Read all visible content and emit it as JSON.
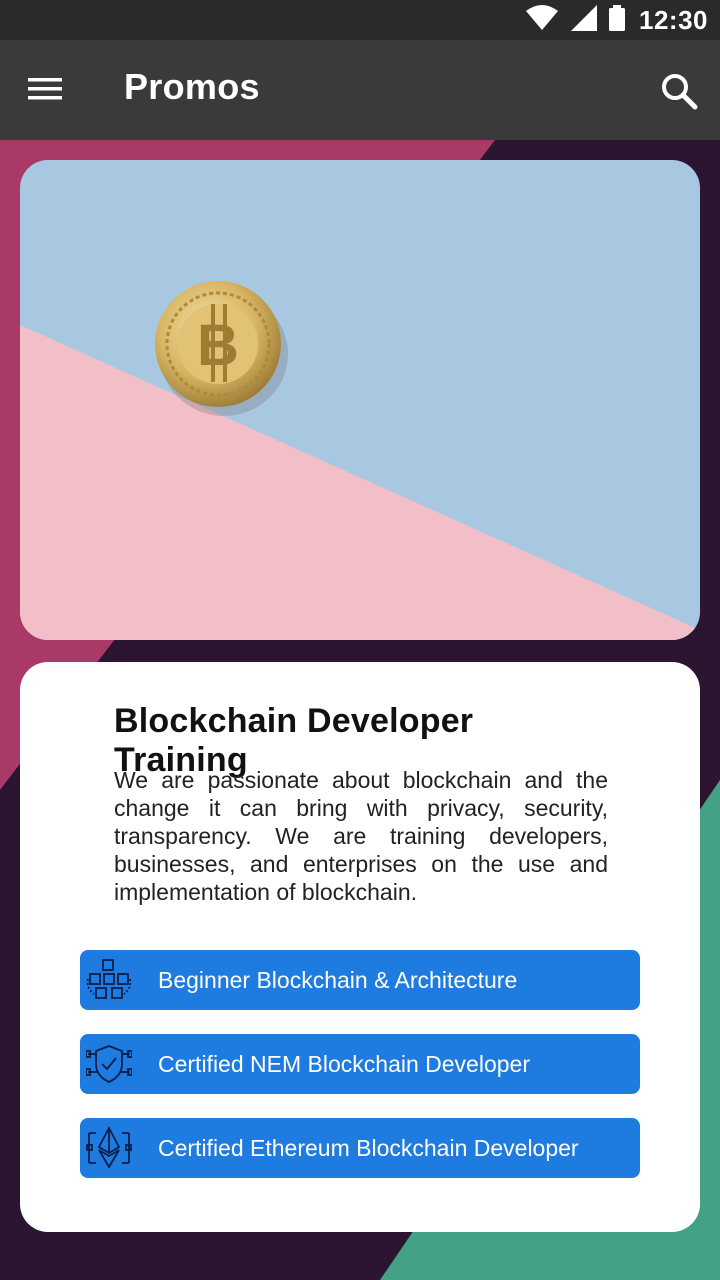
{
  "status_bar": {
    "time": "12:30"
  },
  "app_bar": {
    "title": "Promos"
  },
  "promo": {
    "title": "Blockchain Developer Training",
    "description": "We are passionate about blockchain and the change it can bring with privacy, security, transparency. We are training developers, businesses, and enterprises on the use and implementation of blockchain.",
    "courses": [
      {
        "label": "Beginner Blockchain & Architecture",
        "icon": "blocks-network-icon"
      },
      {
        "label": "Certified NEM Blockchain Developer",
        "icon": "shield-network-icon"
      },
      {
        "label": "Certified Ethereum Blockchain Developer",
        "icon": "ethereum-icon"
      }
    ]
  },
  "colors": {
    "status_bar": "#2a2a2a",
    "app_bar": "#3a3a3a",
    "button": "#1e7be0",
    "hero_blue": "#a8c8e2",
    "hero_pink": "#f2bfc8"
  }
}
